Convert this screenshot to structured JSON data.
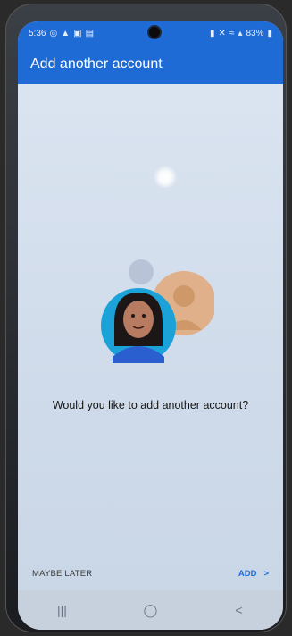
{
  "status": {
    "time": "5:36",
    "battery": "83%"
  },
  "appbar": {
    "title": "Add another account"
  },
  "main": {
    "question": "Would you like to add another account?"
  },
  "actions": {
    "maybe_later": "MAYBE LATER",
    "add": "ADD",
    "add_chevron": ">"
  },
  "navbar": {
    "recent_glyph": "|||",
    "home_glyph": "◯",
    "back_glyph": "<"
  },
  "colors": {
    "primary": "#1f6bd6",
    "background": "#dde6f2"
  }
}
